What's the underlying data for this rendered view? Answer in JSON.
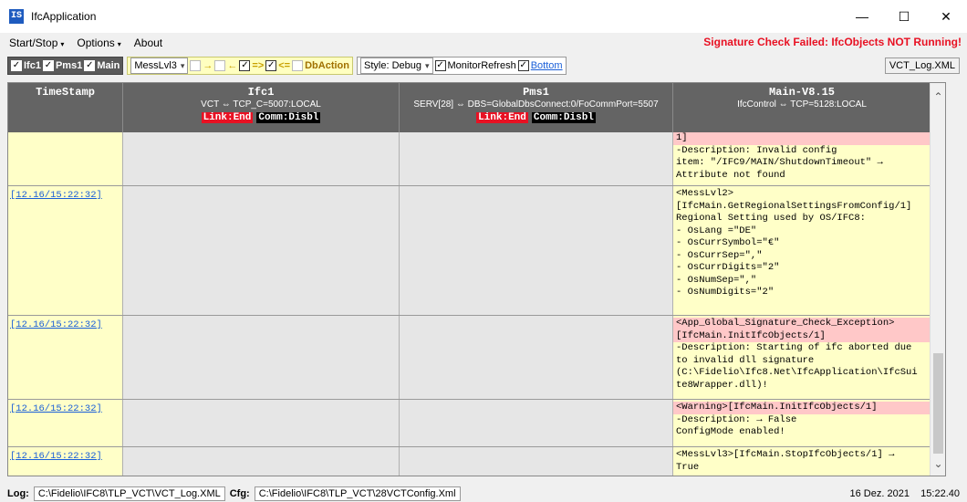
{
  "window": {
    "icon_text": "IS",
    "title": "IfcApplication",
    "minimize": "—",
    "maximize": "☐",
    "close": "✕"
  },
  "menu": {
    "items": [
      {
        "label": "Start/Stop"
      },
      {
        "label": "Options"
      },
      {
        "label": "About"
      }
    ],
    "arrow": "▾",
    "alert": "Signature Check Failed: IfcObjects NOT Running!"
  },
  "toolbar": {
    "filters": [
      {
        "label": "Ifc1",
        "checked": true
      },
      {
        "label": "Pms1",
        "checked": true
      },
      {
        "label": "Main",
        "checked": true
      }
    ],
    "level_select": "MessLvl3",
    "direction_flags": [
      {
        "arrow": "→",
        "checked": false
      },
      {
        "arrow": "←",
        "checked": false
      },
      {
        "arrow": "=>",
        "checked": true
      },
      {
        "arrow": "<=",
        "checked": true
      }
    ],
    "dbaction_label": "DbAction",
    "style_select": "Style: Debug",
    "monitor_refresh": "MonitorRefresh",
    "bottom_link": "Bottom",
    "log_file": "VCT_Log.XML",
    "check_mark": "✓"
  },
  "columns": [
    {
      "name": "TimeStamp",
      "sub": "",
      "status1": "",
      "status2": ""
    },
    {
      "name": "Ifc1",
      "sub": "VCT ⇔ TCP_C=5007:LOCAL",
      "status1": "Link:End",
      "status2": "Comm:Disbl"
    },
    {
      "name": "Pms1",
      "sub": "SERV[28] ⇔ DBS=GlobalDbsConnect:0/FoCommPort=5507",
      "status1": "Link:End",
      "status2": "Comm:Disbl"
    },
    {
      "name": "Main-V8.15",
      "sub": "IfcControl ⇔ TCP=5128:LOCAL",
      "status1": "",
      "status2": ""
    }
  ],
  "rows": [
    {
      "timestamp": "",
      "header": "1]",
      "header_pink": true,
      "body": "-Description: Invalid config\nitem: \"/IFC9/MAIN/ShutdownTimeout\" →\nAttribute not found"
    },
    {
      "timestamp": "[12.16/15:22:32]",
      "header": "",
      "header_pink": false,
      "body": "<MessLvl2>\n[IfcMain.GetRegionalSettingsFromConfig/1]\nRegional Setting used by OS/IFC8:\n- OsLang =\"DE\"\n- OsCurrSymbol=\"€\"\n- OsCurrSep=\",\"\n- OsCurrDigits=\"2\"\n- OsNumSep=\",\"\n- OsNumDigits=\"2\""
    },
    {
      "timestamp": "[12.16/15:22:32]",
      "header": "<App_Global_Signature_Check_Exception>\n[IfcMain.InitIfcObjects/1]",
      "header_pink": true,
      "body": "-Description: Starting of ifc aborted due\nto invalid dll signature\n(C:\\Fidelio\\Ifc8.Net\\IfcApplication\\IfcSui\nte8Wrapper.dll)!"
    },
    {
      "timestamp": "[12.16/15:22:32]",
      "header": "<Warning>[IfcMain.InitIfcObjects/1]",
      "header_pink": true,
      "body": "-Description: → False\nConfigMode enabled!"
    },
    {
      "timestamp": "[12.16/15:22:32]",
      "header": "",
      "header_pink": false,
      "body": "<MessLvl3>[IfcMain.StopIfcObjects/1] →\nTrue"
    }
  ],
  "statusbar": {
    "log_label": "Log:",
    "log_path": "C:\\Fidelio\\IFC8\\TLP_VCT\\VCT_Log.XML",
    "cfg_label": "Cfg:",
    "cfg_path": "C:\\Fidelio\\IFC8\\TLP_VCT\\28VCTConfig.Xml",
    "date": "16 Dez. 2021",
    "time": "15:22.40"
  },
  "scroll": {
    "up": "⌃",
    "down": "⌄"
  }
}
